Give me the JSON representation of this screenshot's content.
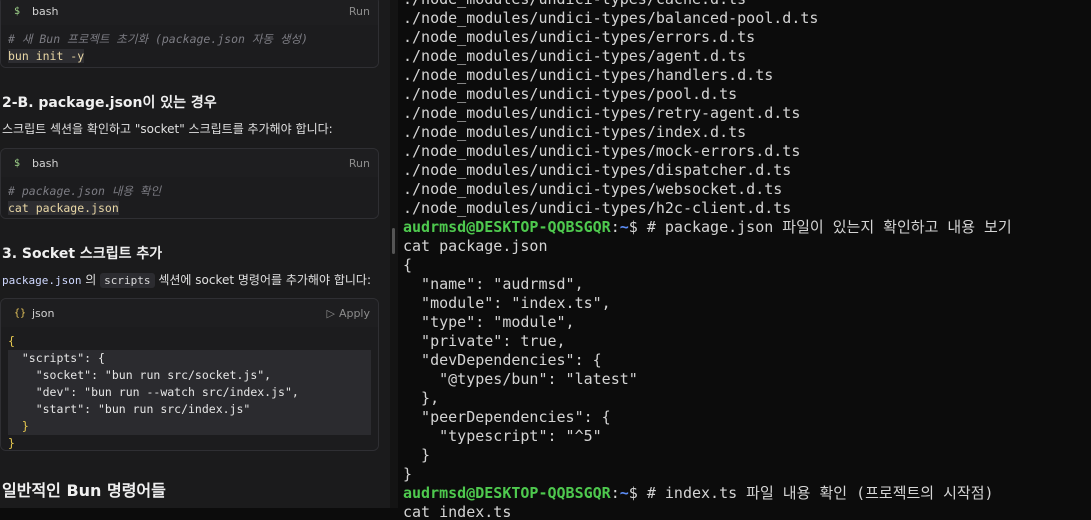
{
  "left": {
    "block1": {
      "lang": "bash",
      "action": "Run",
      "comment": "# 새 Bun 프로젝트 초기화 (package.json 자동 생성)",
      "code": "bun init -y"
    },
    "heading_2b": "2-B. package.json이 있는 경우",
    "para_2b": "스크립트 섹션을 확인하고 \"socket\" 스크립트를 추가해야 합니다:",
    "block2": {
      "lang": "bash",
      "action": "Run",
      "comment": "# package.json 내용 확인",
      "code": "cat package.json"
    },
    "heading_3": "3. Socket 스크립트 추가",
    "para_3": {
      "code1": "package.json",
      "t1": " 의 ",
      "code2": "scripts",
      "t2": " 섹션에 socket 명령어를 추가해야 합니다:"
    },
    "block3": {
      "lang": "json",
      "action": "Apply",
      "lines": [
        "{",
        "  \"scripts\": {",
        "    \"socket\": \"bun run src/socket.js\",",
        "    \"dev\": \"bun run --watch src/index.js\",",
        "    \"start\": \"bun run src/index.js\"",
        "  }",
        "}"
      ]
    },
    "heading_general": "일반적인 Bun 명령어들"
  },
  "terminal": {
    "user": "audrmsd@DESKTOP-QQBSGQR",
    "path": "~",
    "top_partial": "./node_modules/undici-types/cache.d.ts",
    "files": [
      "./node_modules/undici-types/balanced-pool.d.ts",
      "./node_modules/undici-types/errors.d.ts",
      "./node_modules/undici-types/agent.d.ts",
      "./node_modules/undici-types/handlers.d.ts",
      "./node_modules/undici-types/pool.d.ts",
      "./node_modules/undici-types/retry-agent.d.ts",
      "./node_modules/undici-types/index.d.ts",
      "./node_modules/undici-types/mock-errors.d.ts",
      "./node_modules/undici-types/dispatcher.d.ts",
      "./node_modules/undici-types/websocket.d.ts",
      "./node_modules/undici-types/h2c-client.d.ts"
    ],
    "cmd1": "# package.json 파일이 있는지 확인하고 내용 보기",
    "cmd1_cont": "cat package.json",
    "output": [
      "{",
      "  \"name\": \"audrmsd\",",
      "  \"module\": \"index.ts\",",
      "  \"type\": \"module\",",
      "  \"private\": true,",
      "  \"devDependencies\": {",
      "    \"@types/bun\": \"latest\"",
      "  },",
      "  \"peerDependencies\": {",
      "    \"typescript\": \"^5\"",
      "  }",
      "}"
    ],
    "cmd2": "# index.ts 파일 내용 확인 (프로젝트의 시작점)",
    "bottom_partial": "cat index.ts"
  }
}
